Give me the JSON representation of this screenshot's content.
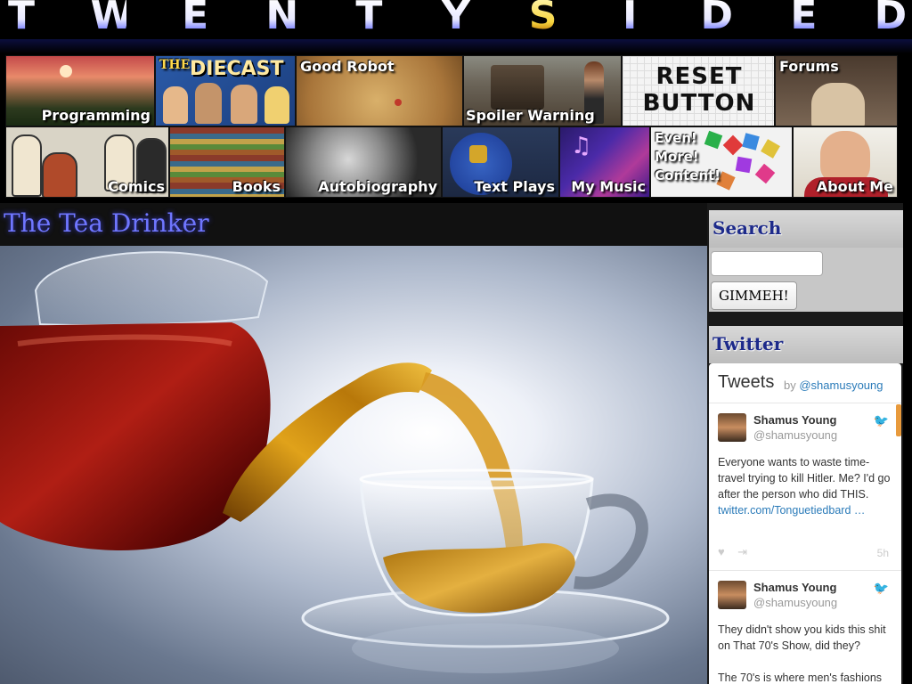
{
  "site": {
    "letters": [
      "T",
      "W",
      "E",
      "N",
      "T",
      "Y",
      "S",
      "I",
      "D",
      "E",
      "D"
    ]
  },
  "nav": {
    "row1": [
      {
        "label": "Programming"
      },
      {
        "label": "DIECAST"
      },
      {
        "label": "Good Robot"
      },
      {
        "label": "Spoiler Warning"
      },
      {
        "label": "RESET BUTTON"
      },
      {
        "label": "Forums"
      }
    ],
    "row2": [
      {
        "label": "Comics"
      },
      {
        "label": "Books"
      },
      {
        "label": "Autobiography"
      },
      {
        "label": "Text Plays"
      },
      {
        "label": "My Music"
      },
      {
        "label": "Even! More! Content!"
      },
      {
        "label": "About Me"
      }
    ],
    "diecast_prefix": "THE"
  },
  "post": {
    "title": "The Tea Drinker"
  },
  "sidebar": {
    "search_heading": "Search",
    "search_placeholder": "",
    "search_button": "GIMMEH!",
    "twitter_heading": "Twitter",
    "twitter": {
      "title": "Tweets",
      "by": "by",
      "handle_link": "@shamusyoung",
      "tweets": [
        {
          "name": "Shamus Young",
          "handle": "@shamusyoung",
          "text": "Everyone wants to waste time-travel trying to kill Hitler. Me? I'd go after the person who did THIS.",
          "link": "twitter.com/Tonguetiedbard …",
          "time": "5h"
        },
        {
          "name": "Shamus Young",
          "handle": "@shamusyoung",
          "text": "They didn't show you kids this shit on That 70's Show, did they?",
          "text2": "The 70's is where men's fashions"
        }
      ]
    }
  },
  "colors": {
    "title_blue": "#6f76ff",
    "sidebar_heading": "#1d2a8a",
    "twitter_link": "#2b7bb9"
  }
}
